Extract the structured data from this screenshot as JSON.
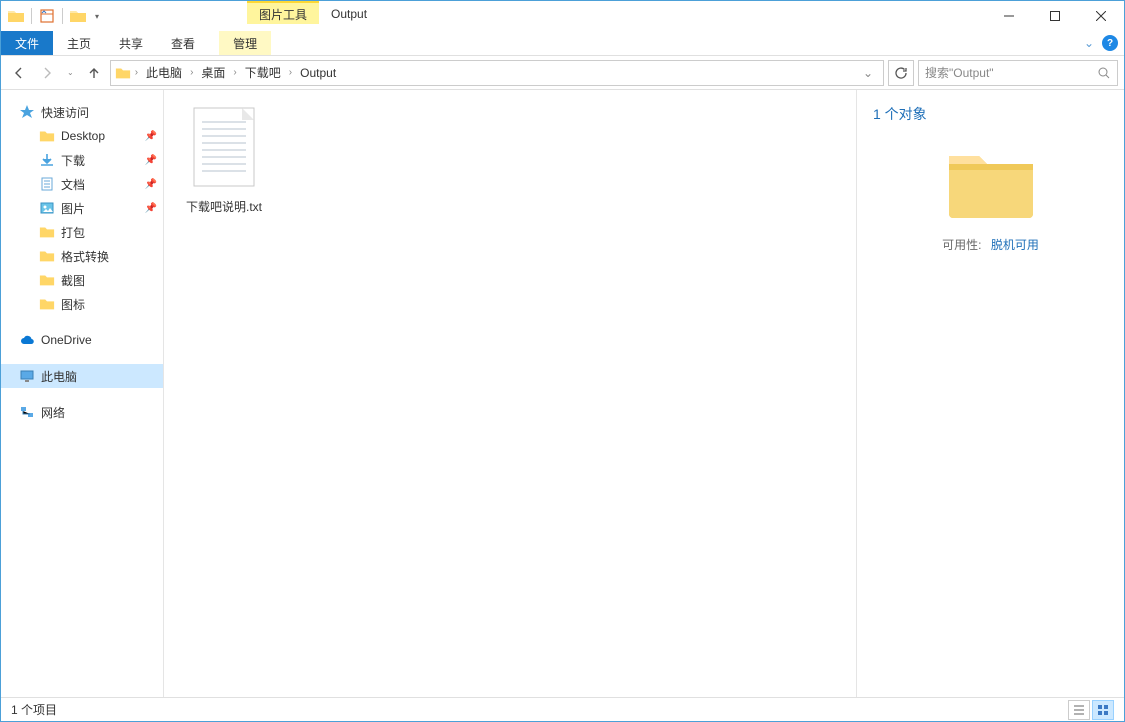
{
  "title": "Output",
  "contextual_tab_group": "图片工具",
  "ribbon": {
    "file": "文件",
    "tabs": [
      "主页",
      "共享",
      "查看"
    ],
    "contextual": "管理"
  },
  "breadcrumbs": [
    "此电脑",
    "桌面",
    "下载吧",
    "Output"
  ],
  "search_placeholder": "搜索\"Output\"",
  "sidebar": {
    "quick_access": "快速访问",
    "quick_items": [
      "Desktop",
      "下载",
      "文档",
      "图片",
      "打包",
      "格式转换",
      "截图",
      "图标"
    ],
    "onedrive": "OneDrive",
    "this_pc": "此电脑",
    "network": "网络"
  },
  "files": [
    {
      "name": "下载吧说明.txt"
    }
  ],
  "details": {
    "header": "1 个对象",
    "prop_key": "可用性:",
    "prop_val": "脱机可用"
  },
  "status": "1 个项目"
}
